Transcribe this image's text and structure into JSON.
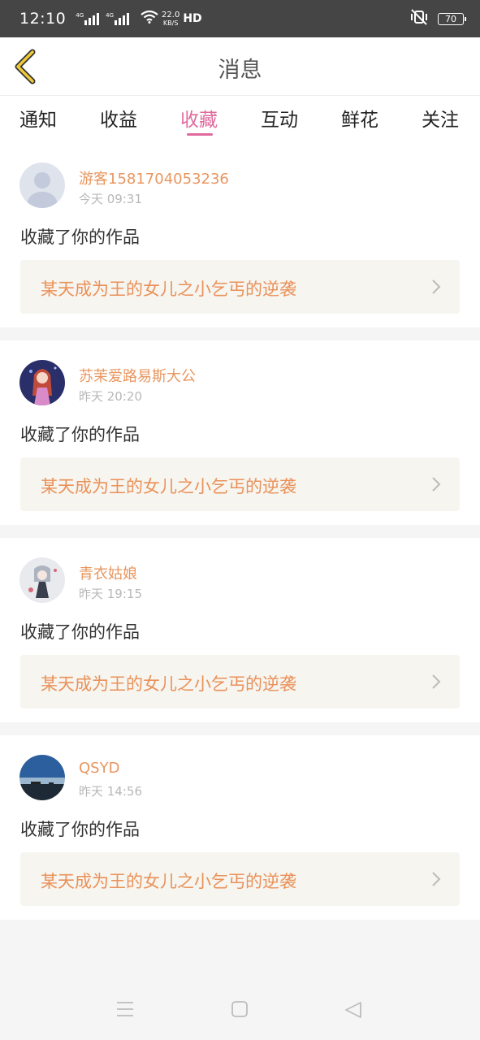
{
  "status_bar": {
    "time": "12:10",
    "net_tag_1": "4G",
    "net_tag_2": "4G",
    "speed_value": "22.0",
    "speed_unit": "KB/S",
    "hd": "HD",
    "battery": "70"
  },
  "header": {
    "title": "消息"
  },
  "tabs": [
    {
      "label": "通知",
      "active": false
    },
    {
      "label": "收益",
      "active": false
    },
    {
      "label": "收藏",
      "active": true
    },
    {
      "label": "互动",
      "active": false
    },
    {
      "label": "鲜花",
      "active": false
    },
    {
      "label": "关注",
      "active": false
    }
  ],
  "messages": [
    {
      "username": "游客1581704053236",
      "time": "今天 09:31",
      "action": "收藏了你的作品",
      "work_title": "某天成为王的女儿之小乞丐的逆袭",
      "avatar": "default-avatar-icon"
    },
    {
      "username": "苏茉爱路易斯大公",
      "time": "昨天 20:20",
      "action": "收藏了你的作品",
      "work_title": "某天成为王的女儿之小乞丐的逆袭",
      "avatar": "anime-girl-avatar"
    },
    {
      "username": "青衣姑娘",
      "time": "昨天 19:15",
      "action": "收藏了你的作品",
      "work_title": "某天成为王的女儿之小乞丐的逆袭",
      "avatar": "anime-character-avatar"
    },
    {
      "username": "QSYD",
      "time": "昨天 14:56",
      "action": "收藏了你的作品",
      "work_title": "某天成为王的女儿之小乞丐的逆袭",
      "avatar": "sea-landscape-avatar"
    }
  ],
  "colors": {
    "accent": "#e06a9d",
    "username": "#e8965f",
    "work_title": "#ea915a",
    "back_icon": "#f0c93a"
  }
}
